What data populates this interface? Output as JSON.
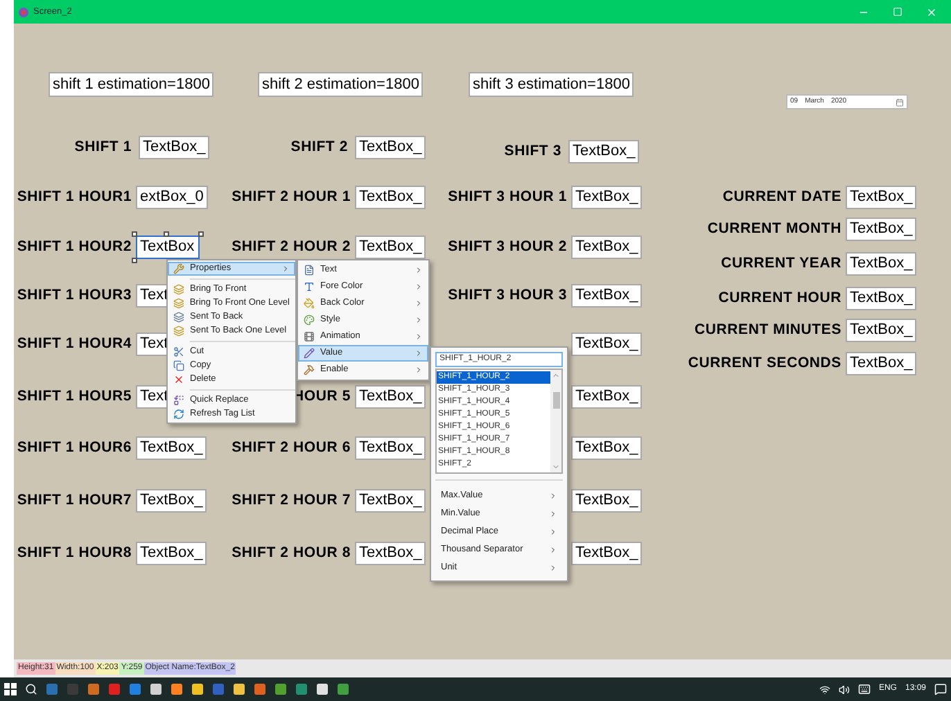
{
  "window": {
    "title": "Screen_2"
  },
  "estimations": [
    "shift 1 estimation=1800",
    "shift 2 estimation=1800",
    "shift 3 estimation=1800"
  ],
  "date_picker": {
    "day": "09",
    "month": "March",
    "year": "2020"
  },
  "shift_fields": [
    {
      "label": "SHIFT 1",
      "value": "TextBox_"
    },
    {
      "label": "SHIFT 2",
      "value": "TextBox_"
    },
    {
      "label": "SHIFT 3",
      "value": "TextBox_"
    }
  ],
  "hour_columns": [
    {
      "rows": [
        {
          "label": "SHIFT 1 HOUR1",
          "value": "extBox_0",
          "selected": false
        },
        {
          "label": "SHIFT 1 HOUR2",
          "value": "TextBox",
          "selected": true
        },
        {
          "label": "SHIFT 1 HOUR3",
          "value": "Text",
          "selected": false
        },
        {
          "label": "SHIFT 1 HOUR4",
          "value": "Text",
          "selected": false
        },
        {
          "label": "SHIFT 1 HOUR5",
          "value": "Text",
          "selected": false
        },
        {
          "label": "SHIFT 1 HOUR6",
          "value": "TextBox_",
          "selected": false
        },
        {
          "label": "SHIFT 1 HOUR7",
          "value": "TextBox_",
          "selected": false
        },
        {
          "label": "SHIFT 1 HOUR8",
          "value": "TextBox_",
          "selected": false
        }
      ]
    },
    {
      "rows": [
        {
          "label": "SHIFT 2 HOUR 1",
          "value": "TextBox_",
          "selected": false
        },
        {
          "label": "SHIFT 2 HOUR 2",
          "value": "TextBox_",
          "selected": false
        },
        {
          "label": "HOUR 5",
          "value": "TextBox_",
          "selected": false
        },
        {
          "label": "SHIFT 2 HOUR 6",
          "value": "TextBox_",
          "selected": false
        },
        {
          "label": "SHIFT 2 HOUR 7",
          "value": "TextBox_",
          "selected": false
        },
        {
          "label": "SHIFT 2 HOUR 8",
          "value": "TextBox_",
          "selected": false
        }
      ]
    },
    {
      "rows": [
        {
          "label": "SHIFT 3 HOUR 1",
          "value": "TextBox_",
          "selected": false
        },
        {
          "label": "SHIFT 3 HOUR 2",
          "value": "TextBox_",
          "selected": false
        },
        {
          "label": "SHIFT 3 HOUR 3",
          "value": "TextBox_",
          "selected": false
        },
        {
          "value": "TextBox_",
          "selected": false
        },
        {
          "value": "TextBox_",
          "selected": false
        },
        {
          "value": "TextBox_",
          "selected": false
        },
        {
          "value": "TextBox_",
          "selected": false
        },
        {
          "value": "TextBox_",
          "selected": false
        }
      ]
    }
  ],
  "current_fields": [
    {
      "label": "CURRENT DATE",
      "value": "TextBox_"
    },
    {
      "label": "CURRENT MONTH",
      "value": "TextBox_"
    },
    {
      "label": "CURRENT YEAR",
      "value": "TextBox_"
    },
    {
      "label": "CURRENT HOUR",
      "value": "TextBox_"
    },
    {
      "label": "CURRENT MINUTES",
      "value": "TextBox_"
    },
    {
      "label": "CURRENT SECONDS",
      "value": "TextBox_"
    }
  ],
  "context_menu": {
    "groups": [
      [
        {
          "label": "Properties",
          "selected": true,
          "has_submenu": true
        }
      ],
      [
        {
          "label": "Bring To Front",
          "selected": false,
          "has_submenu": false
        },
        {
          "label": "Bring To Front One Level",
          "selected": false,
          "has_submenu": false
        },
        {
          "label": "Sent To Back",
          "selected": false,
          "has_submenu": false
        },
        {
          "label": "Sent To Back One Level",
          "selected": false,
          "has_submenu": false
        }
      ],
      [
        {
          "label": "Cut",
          "selected": false,
          "has_submenu": false
        },
        {
          "label": "Copy",
          "selected": false,
          "has_submenu": false
        },
        {
          "label": "Delete",
          "selected": false,
          "has_submenu": false
        }
      ],
      [
        {
          "label": "Quick Replace",
          "selected": false,
          "has_submenu": false
        },
        {
          "label": "Refresh Tag List",
          "selected": false,
          "has_submenu": false
        }
      ]
    ]
  },
  "properties_submenu": [
    {
      "label": "Text",
      "selected": false,
      "has_submenu": true
    },
    {
      "label": "Fore Color",
      "selected": false,
      "has_submenu": true
    },
    {
      "label": "Back Color",
      "selected": false,
      "has_submenu": true
    },
    {
      "label": "Style",
      "selected": false,
      "has_submenu": true
    },
    {
      "label": "Animation",
      "selected": false,
      "has_submenu": true
    },
    {
      "label": "Value",
      "selected": true,
      "has_submenu": true
    },
    {
      "label": "Enable",
      "selected": false,
      "has_submenu": true
    }
  ],
  "value_submenu": {
    "field": "SHIFT_1_HOUR_2",
    "tags": [
      {
        "label": "SHIFT_1_HOUR_2",
        "selected": true
      },
      {
        "label": "SHIFT_1_HOUR_3",
        "selected": false
      },
      {
        "label": "SHIFT_1_HOUR_4",
        "selected": false
      },
      {
        "label": "SHIFT_1_HOUR_5",
        "selected": false
      },
      {
        "label": "SHIFT_1_HOUR_6",
        "selected": false
      },
      {
        "label": "SHIFT_1_HOUR_7",
        "selected": false
      },
      {
        "label": "SHIFT_1_HOUR_8",
        "selected": false
      },
      {
        "label": "SHIFT_2",
        "selected": false
      }
    ],
    "items": [
      {
        "label": "Max.Value",
        "has_submenu": true
      },
      {
        "label": "Min.Value",
        "has_submenu": true
      },
      {
        "label": "Decimal Place",
        "has_submenu": true
      },
      {
        "label": "Thousand Separator",
        "has_submenu": true
      },
      {
        "label": "Unit",
        "has_submenu": true
      }
    ]
  },
  "status_bar": [
    {
      "text": "Height:31",
      "color": "#f4b8c0"
    },
    {
      "text": "Width:100",
      "color": "#f8dcc0"
    },
    {
      "text": "X:203",
      "color": "#f6f2b0"
    },
    {
      "text": "Y:259",
      "color": "#c8f0c0"
    },
    {
      "text": "Object Name:TextBox_2",
      "color": "#c4c4f2"
    }
  ],
  "taskbar": {
    "language": "ENG",
    "time": "13:09"
  }
}
